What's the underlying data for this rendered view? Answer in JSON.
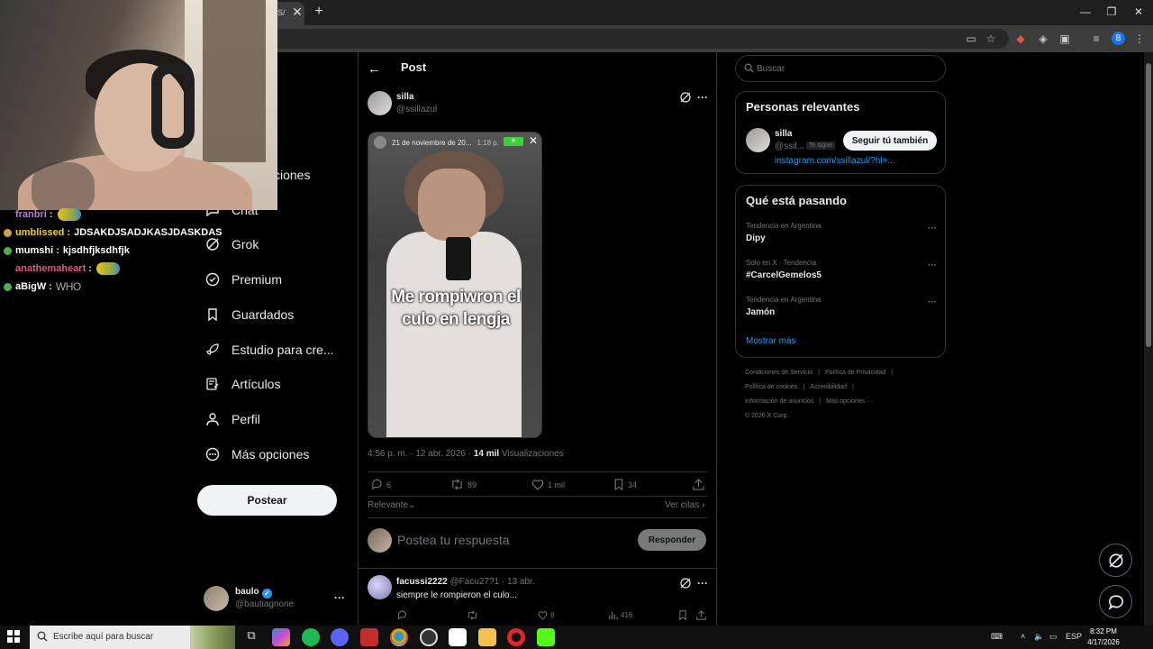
{
  "browser": {
    "tab_title": "S/",
    "close_glyph": "✕",
    "new_tab_glyph": "+",
    "window_controls": [
      "—",
      "❐",
      "✕"
    ],
    "profile_initial": "B"
  },
  "webcam": {},
  "chat": {
    "lines": [
      {
        "user": "franbri",
        "user_color": "#b57edc",
        "badge_color": "#000000",
        "sep": ":",
        "msg": "",
        "emote": true
      },
      {
        "user": "umblissed",
        "user_color": "#ffd000",
        "badge_color": "#c9a64a",
        "sep": ":",
        "msg": "JDSAKDJSADJKASJDASKDAS",
        "emote": false
      },
      {
        "user": "mumshi",
        "user_color": "#ffffff",
        "badge_color": "#4caf50",
        "sep": ":",
        "msg": "kjsdhfjksdhfjk",
        "emote": false
      },
      {
        "user": "anathemaheart",
        "user_color": "#e05a7a",
        "badge_color": "#000000",
        "sep": ":",
        "msg": "",
        "emote": true
      },
      {
        "user": "aBigW",
        "user_color": "#ffffff",
        "badge_color": "#4caf50",
        "sep": ":",
        "msg": "WHO",
        "emote": false
      }
    ]
  },
  "nav": {
    "partial_top": "ciones",
    "items": [
      {
        "label": "Chat",
        "icon": "chat-icon"
      },
      {
        "label": "Grok",
        "icon": "grok-icon"
      },
      {
        "label": "Premium",
        "icon": "premium-icon"
      },
      {
        "label": "Guardados",
        "icon": "bookmark-icon"
      },
      {
        "label": "Estudio para cre...",
        "icon": "rocket-icon"
      },
      {
        "label": "Artículos",
        "icon": "article-icon"
      },
      {
        "label": "Perfil",
        "icon": "profile-icon"
      },
      {
        "label": "Más opciones",
        "icon": "more-circle-icon"
      }
    ],
    "post_button": "Postear",
    "account": {
      "name": "baulo",
      "handle": "@bautiagnone",
      "more": "···"
    }
  },
  "post": {
    "heading": "Post",
    "author_name": "silla",
    "author_handle": "@ssillazul",
    "media": {
      "story_date": "21 de noviembre de 20...",
      "story_time": "1:18 p.",
      "caption_line1": "Me rompiwron el",
      "caption_line2": "culo en lengja"
    },
    "meta": {
      "time": "4:56 p. m. · 12 abr. 2026 · ",
      "views_count": "14 mil",
      "views_label": " Visualizaciones"
    },
    "actions": {
      "replies": "6",
      "reposts": "89",
      "likes": "1 mil",
      "bookmarks": "34"
    },
    "sort_label": "Relevante",
    "quotes_label": "Ver citas",
    "reply_placeholder": "Postea tu respuesta",
    "reply_button": "Responder"
  },
  "comment": {
    "name": "facussi2222",
    "handle": "@Facu27?1",
    "date": " · 13 abr.",
    "text": "siempre le rompieron el culo...",
    "actions": {
      "reposts": "",
      "likes": "8",
      "views": "416"
    }
  },
  "right": {
    "search_placeholder": "Buscar",
    "relevant_title": "Personas relevantes",
    "relevant": {
      "name": "silla",
      "handle": "@ssil...",
      "follows_you": "Te sigue",
      "follow_button": "Seguir tú también",
      "link": "instagram.com/ssillazul/?hl=..."
    },
    "trends_title": "Qué está pasando",
    "trends": [
      {
        "context": "Tendencia en Argentina",
        "name": "Dipy"
      },
      {
        "context": "Solo en X · Tendencia",
        "name": "#CarcelGemelos5"
      },
      {
        "context": "Tendencia en Argentina",
        "name": "Jamón"
      }
    ],
    "show_more": "Mostrar más",
    "footer": [
      [
        "Condiciones de Servicio",
        "|",
        "Política de Privacidad",
        "|"
      ],
      [
        "Política de cookies",
        "|",
        "Accesibilidad",
        "|"
      ],
      [
        "Información de anuncios",
        "|",
        "Más opciones ···"
      ],
      [
        "© 2026 X Corp."
      ]
    ]
  },
  "taskbar": {
    "search_placeholder": "Escribe aquí para buscar",
    "lang": "ESP",
    "time": "8:32 PM",
    "date": "4/17/2026"
  },
  "colors": {
    "accent": "#1d9bf0",
    "border": "#2f3336",
    "muted": "#71767b"
  }
}
